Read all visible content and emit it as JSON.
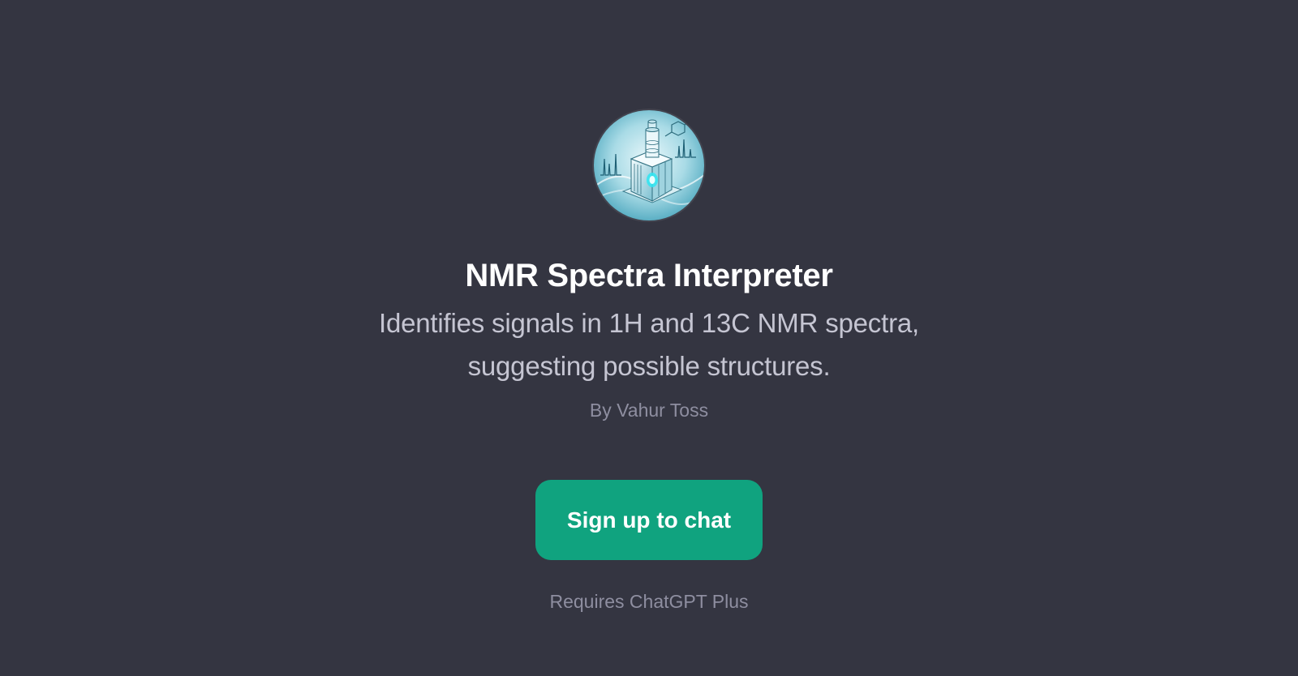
{
  "gpt": {
    "title": "NMR Spectra Interpreter",
    "description": "Identifies signals in 1H and 13C NMR spectra, suggesting possible structures.",
    "author": "By Vahur Toss",
    "avatar_icon": "nmr-spectrometer-illustration"
  },
  "actions": {
    "signup_label": "Sign up to chat"
  },
  "footer": {
    "requirement": "Requires ChatGPT Plus"
  },
  "colors": {
    "background": "#343541",
    "accent": "#10a37f",
    "title": "#ffffff",
    "description": "#c5c5d2",
    "muted": "#8e8ea0"
  }
}
